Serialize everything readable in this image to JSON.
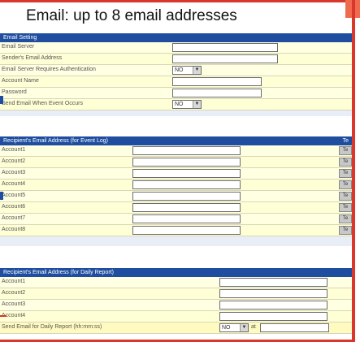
{
  "caption": "Email:  up to 8 email addresses",
  "email_setting": {
    "header": "Email Setting",
    "rows": [
      {
        "label": "Email Server",
        "type": "text"
      },
      {
        "label": "Sender's Email Address",
        "type": "text"
      },
      {
        "label": "Email Server Requires Authentication",
        "type": "select",
        "value": "NO"
      },
      {
        "label": "Account Name",
        "type": "text"
      },
      {
        "label": "Password",
        "type": "text"
      },
      {
        "label": "Send Email When Event Occurs",
        "type": "select",
        "value": "NO"
      }
    ]
  },
  "event_log": {
    "header": "Recipient's Email Address (for Event Log)",
    "header_right": "Te",
    "button_label": "Te",
    "accounts": [
      "Account1",
      "Account2",
      "Account3",
      "Account4",
      "Account5",
      "Account6",
      "Account7",
      "Account8"
    ]
  },
  "daily_report": {
    "header": "Recipient's Email Address (for Daily Report)",
    "accounts": [
      "Account1",
      "Account2",
      "Account3",
      "Account4"
    ],
    "last_row": {
      "label": "Send Email for Daily Report (hh:mm:ss)",
      "select_value": "NO",
      "separator": "at"
    }
  }
}
